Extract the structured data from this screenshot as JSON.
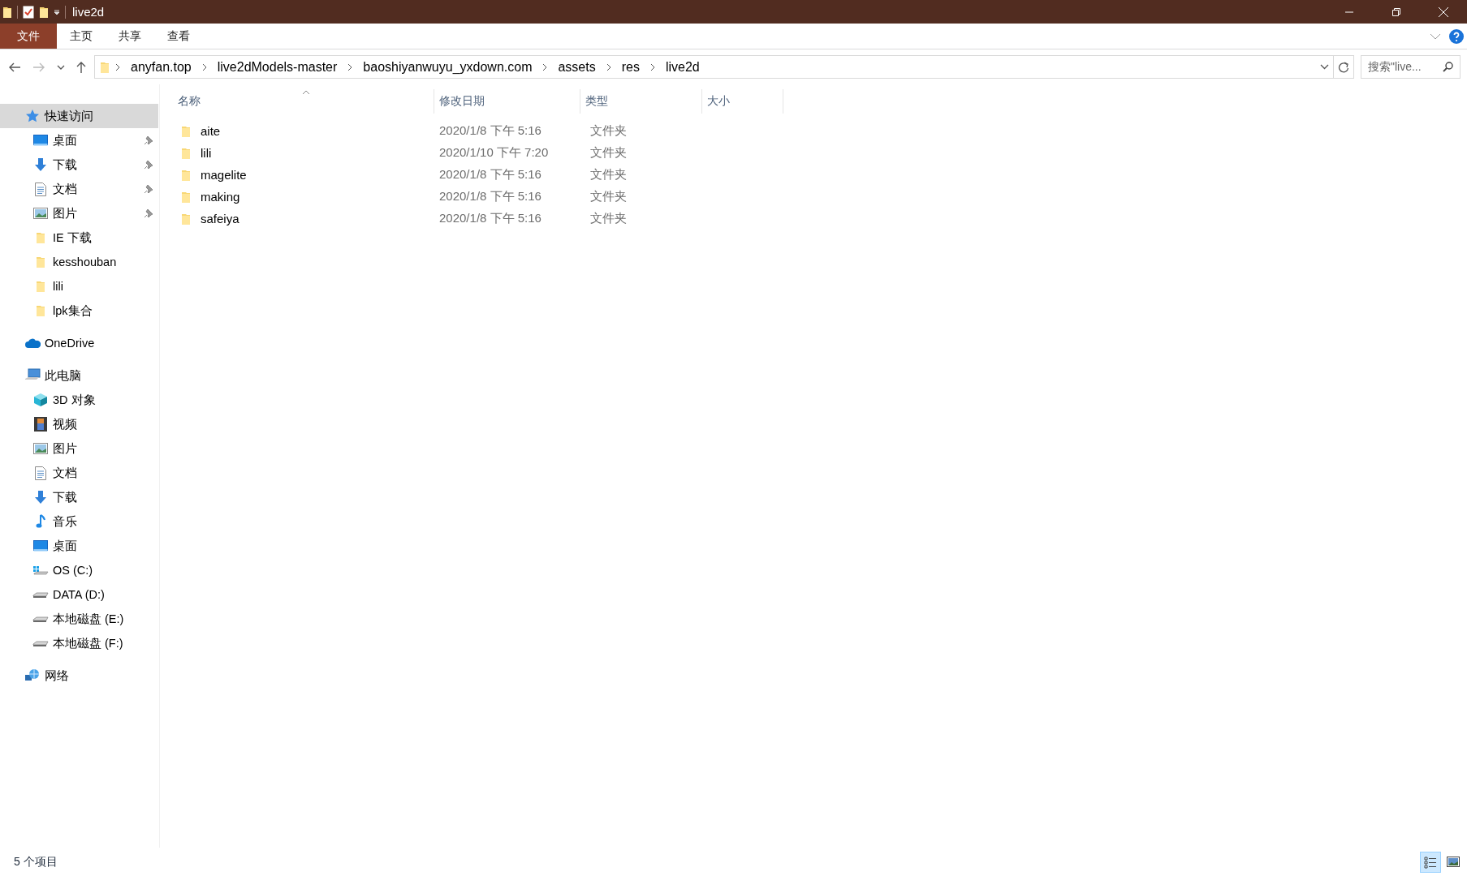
{
  "window": {
    "title": "live2d"
  },
  "ribbon_tabs": [
    {
      "label": "文件",
      "kind": "file"
    },
    {
      "label": "主页",
      "kind": "tab"
    },
    {
      "label": "共享",
      "kind": "tab"
    },
    {
      "label": "查看",
      "kind": "tab"
    }
  ],
  "address_bar": {
    "breadcrumbs": [
      "anyfan.top",
      "live2dModels-master",
      "baoshiyanwuyu_yxdown.com",
      "assets",
      "res",
      "live2d"
    ]
  },
  "search": {
    "placeholder": "搜索\"live..."
  },
  "sidebar": {
    "items": [
      {
        "label": "快速访问",
        "kind": "star",
        "selected": true,
        "children": [
          {
            "label": "桌面",
            "kind": "desktop",
            "pinned": true
          },
          {
            "label": "下载",
            "kind": "download",
            "pinned": true
          },
          {
            "label": "文档",
            "kind": "document",
            "pinned": true
          },
          {
            "label": "图片",
            "kind": "picture",
            "pinned": true
          },
          {
            "label": "IE 下载",
            "kind": "folder",
            "pinned": false
          },
          {
            "label": "kesshouban",
            "kind": "folder",
            "pinned": false
          },
          {
            "label": "lili",
            "kind": "folder",
            "pinned": false
          },
          {
            "label": "lpk集合",
            "kind": "folder",
            "pinned": false
          }
        ]
      },
      {
        "label": "OneDrive",
        "kind": "cloud",
        "selected": false
      },
      {
        "label": "此电脑",
        "kind": "pc",
        "selected": false,
        "children": [
          {
            "label": "3D 对象",
            "kind": "cube",
            "pinned": false
          },
          {
            "label": "视频",
            "kind": "video",
            "pinned": false
          },
          {
            "label": "图片",
            "kind": "picture",
            "pinned": false
          },
          {
            "label": "文档",
            "kind": "document",
            "pinned": false
          },
          {
            "label": "下载",
            "kind": "download",
            "pinned": false
          },
          {
            "label": "音乐",
            "kind": "music",
            "pinned": false
          },
          {
            "label": "桌面",
            "kind": "desktop",
            "pinned": false
          },
          {
            "label": "OS (C:)",
            "kind": "osdrive",
            "pinned": false
          },
          {
            "label": "DATA (D:)",
            "kind": "drive",
            "pinned": false
          },
          {
            "label": "本地磁盘 (E:)",
            "kind": "drive",
            "pinned": false
          },
          {
            "label": "本地磁盘 (F:)",
            "kind": "drive",
            "pinned": false
          }
        ]
      },
      {
        "label": "网络",
        "kind": "network",
        "selected": false
      }
    ]
  },
  "table": {
    "columns": [
      {
        "label": "名称",
        "sorted": true
      },
      {
        "label": "修改日期",
        "sorted": false
      },
      {
        "label": "类型",
        "sorted": false
      },
      {
        "label": "大小",
        "sorted": false
      }
    ],
    "rows": [
      {
        "name": "aite",
        "modified": "2020/1/8 下午 5:16",
        "type": "文件夹"
      },
      {
        "name": "lili",
        "modified": "2020/1/10 下午 7:20",
        "type": "文件夹"
      },
      {
        "name": "magelite",
        "modified": "2020/1/8 下午 5:16",
        "type": "文件夹"
      },
      {
        "name": "making",
        "modified": "2020/1/8 下午 5:16",
        "type": "文件夹"
      },
      {
        "name": "safeiya",
        "modified": "2020/1/8 下午 5:16",
        "type": "文件夹"
      }
    ]
  },
  "status_bar": {
    "text": "5 个项目",
    "view_buttons": [
      {
        "kind": "details",
        "selected": true
      },
      {
        "kind": "large-icons",
        "selected": false
      }
    ]
  }
}
